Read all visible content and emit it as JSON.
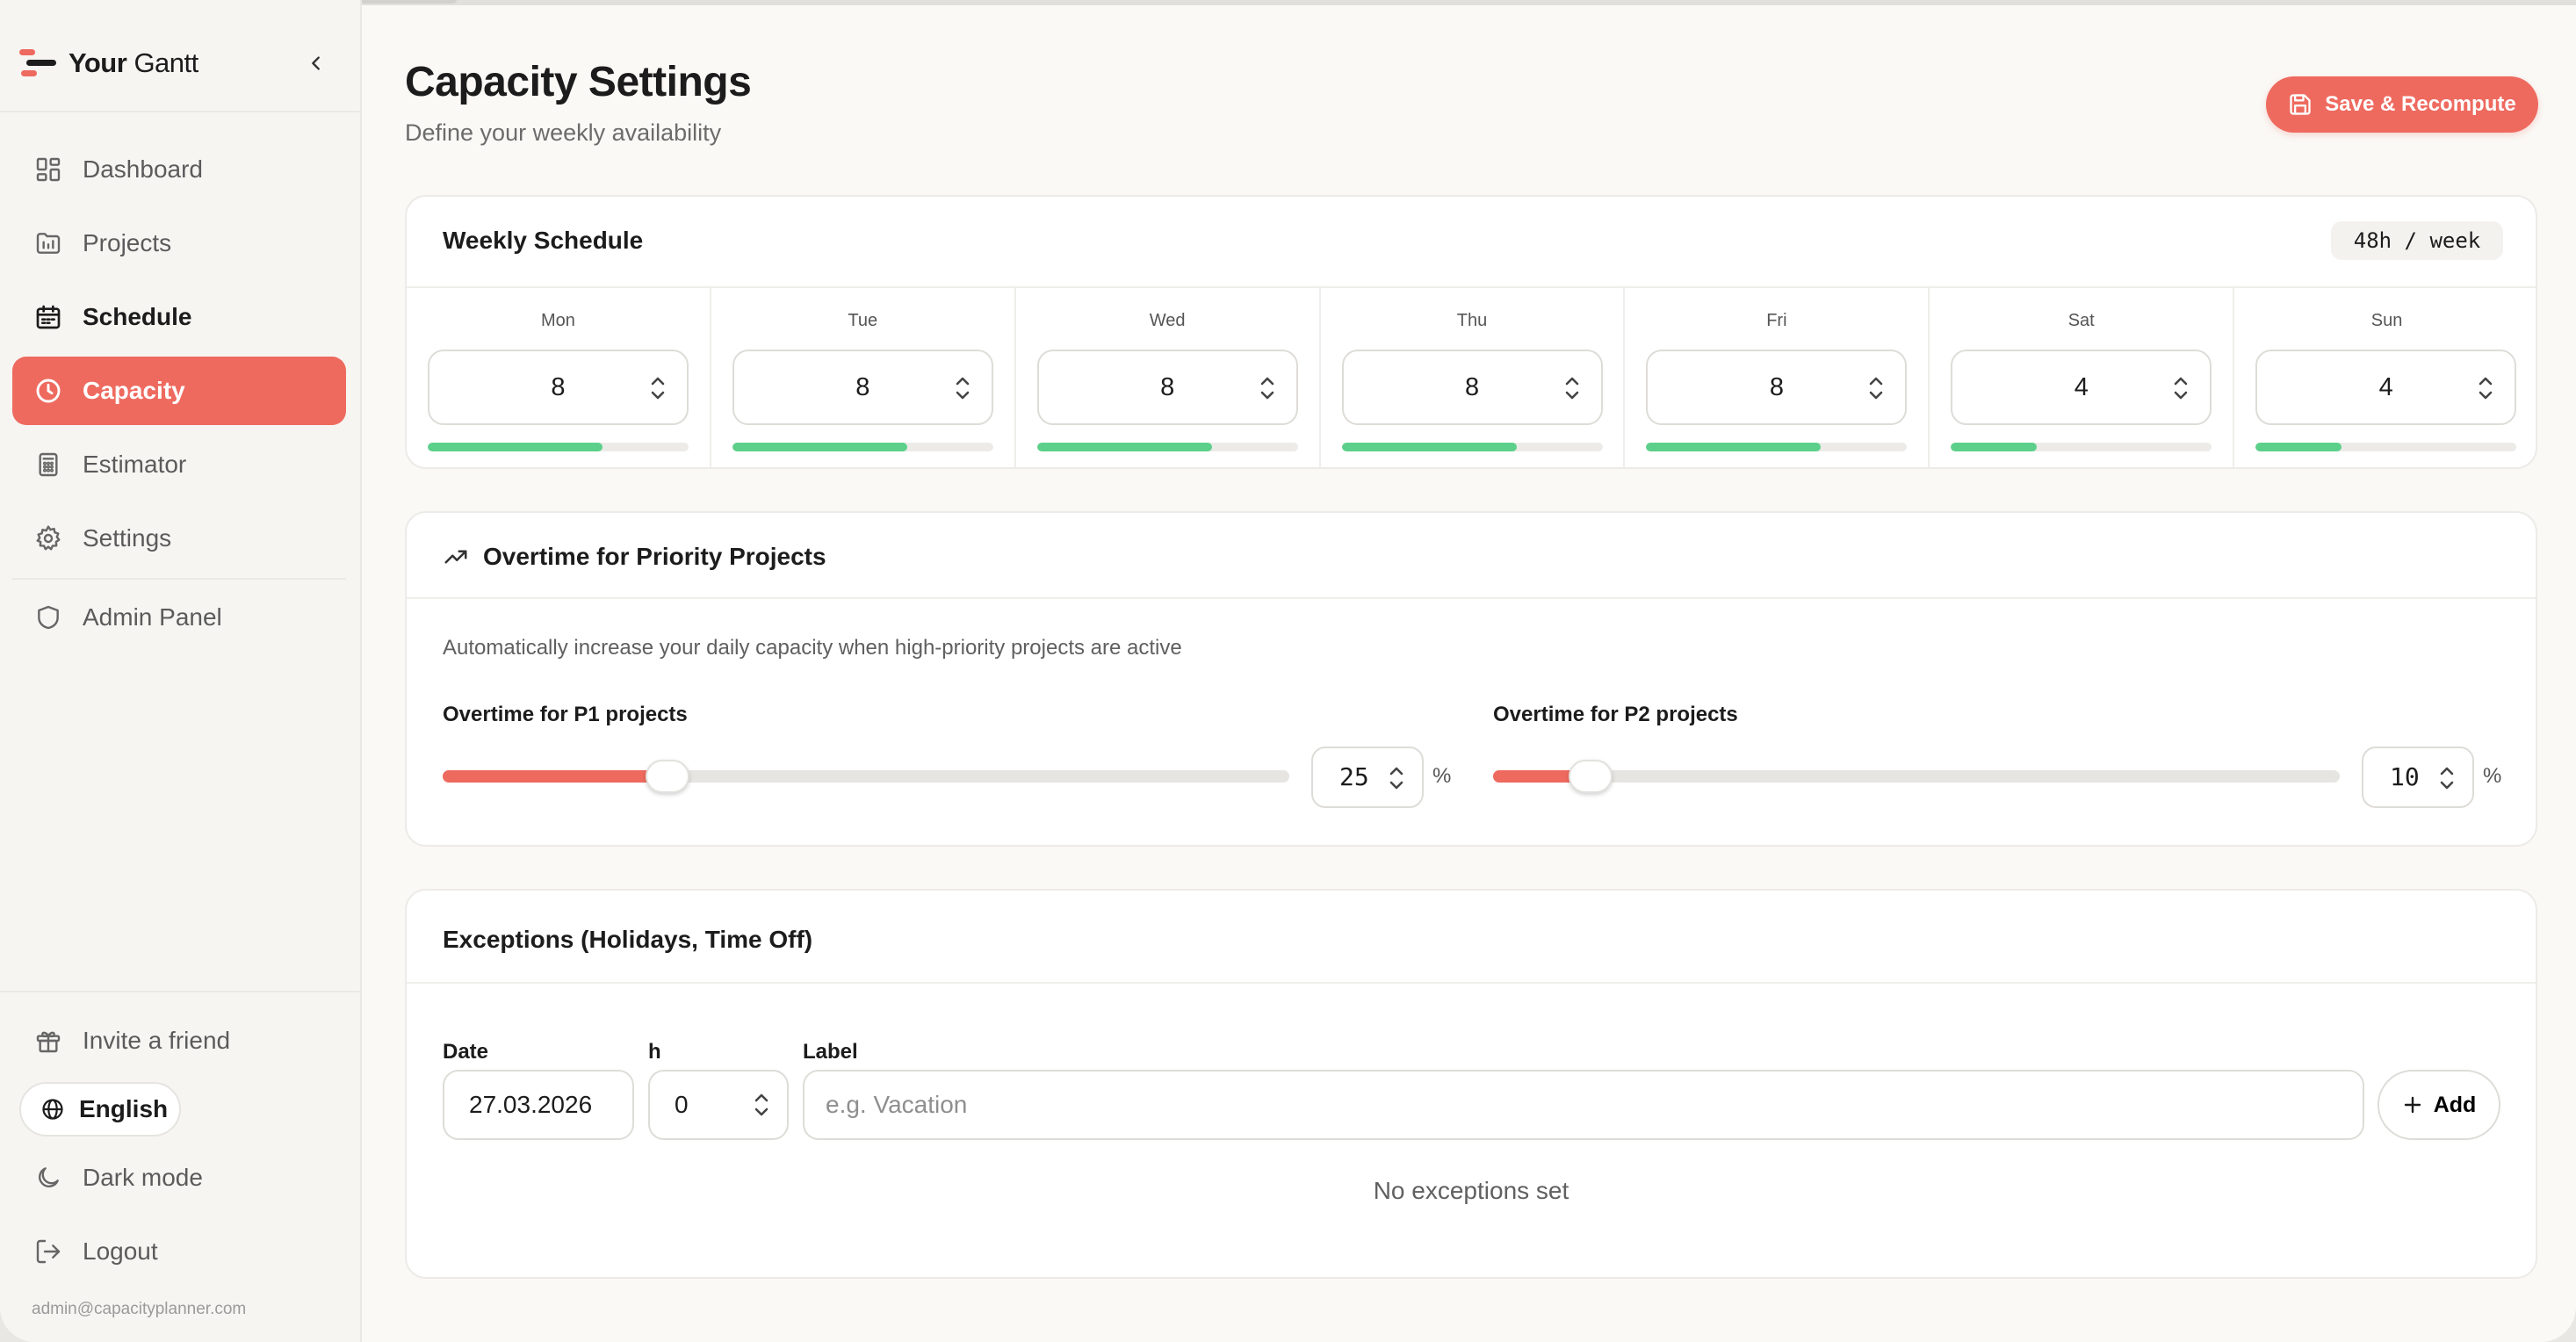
{
  "app": {
    "logo_bold": "Your",
    "logo_light": "Gantt"
  },
  "sidebar": {
    "items": [
      {
        "label": "Dashboard",
        "icon": "dashboard-icon"
      },
      {
        "label": "Projects",
        "icon": "projects-icon"
      },
      {
        "label": "Schedule",
        "icon": "calendar-icon"
      },
      {
        "label": "Capacity",
        "icon": "clock-icon",
        "active": true
      },
      {
        "label": "Estimator",
        "icon": "calculator-icon"
      },
      {
        "label": "Settings",
        "icon": "gear-icon"
      },
      {
        "label": "Admin Panel",
        "icon": "shield-icon"
      }
    ],
    "footer": {
      "invite": "Invite a friend",
      "language": "English",
      "dark_mode": "Dark mode",
      "logout": "Logout",
      "email": "admin@capacityplanner.com"
    }
  },
  "header": {
    "title": "Capacity Settings",
    "subtitle": "Define your weekly availability",
    "save_label": "Save & Recompute"
  },
  "weekly": {
    "title": "Weekly Schedule",
    "badge": "48h / week",
    "days": [
      {
        "name": "Mon",
        "hours": "8",
        "fill": 0.67
      },
      {
        "name": "Tue",
        "hours": "8",
        "fill": 0.67
      },
      {
        "name": "Wed",
        "hours": "8",
        "fill": 0.67
      },
      {
        "name": "Thu",
        "hours": "8",
        "fill": 0.67
      },
      {
        "name": "Fri",
        "hours": "8",
        "fill": 0.67
      },
      {
        "name": "Sat",
        "hours": "4",
        "fill": 0.33
      },
      {
        "name": "Sun",
        "hours": "4",
        "fill": 0.33
      }
    ]
  },
  "overtime": {
    "title": "Overtime for Priority Projects",
    "description": "Automatically increase your daily capacity when high-priority projects are active",
    "p1": {
      "label": "Overtime for P1 projects",
      "value": "25",
      "fraction": 0.25,
      "unit": "%"
    },
    "p2": {
      "label": "Overtime for P2 projects",
      "value": "10",
      "fraction": 0.1,
      "unit": "%"
    }
  },
  "exceptions": {
    "title": "Exceptions (Holidays, Time Off)",
    "date_label": "Date",
    "hours_label": "h",
    "label_label": "Label",
    "date_value": "27.03.2026",
    "hours_value": "0",
    "label_placeholder": "e.g. Vacation",
    "add_label": "Add",
    "empty": "No exceptions set"
  },
  "colors": {
    "accent": "#ee6a5f",
    "success": "#5cd08a"
  }
}
